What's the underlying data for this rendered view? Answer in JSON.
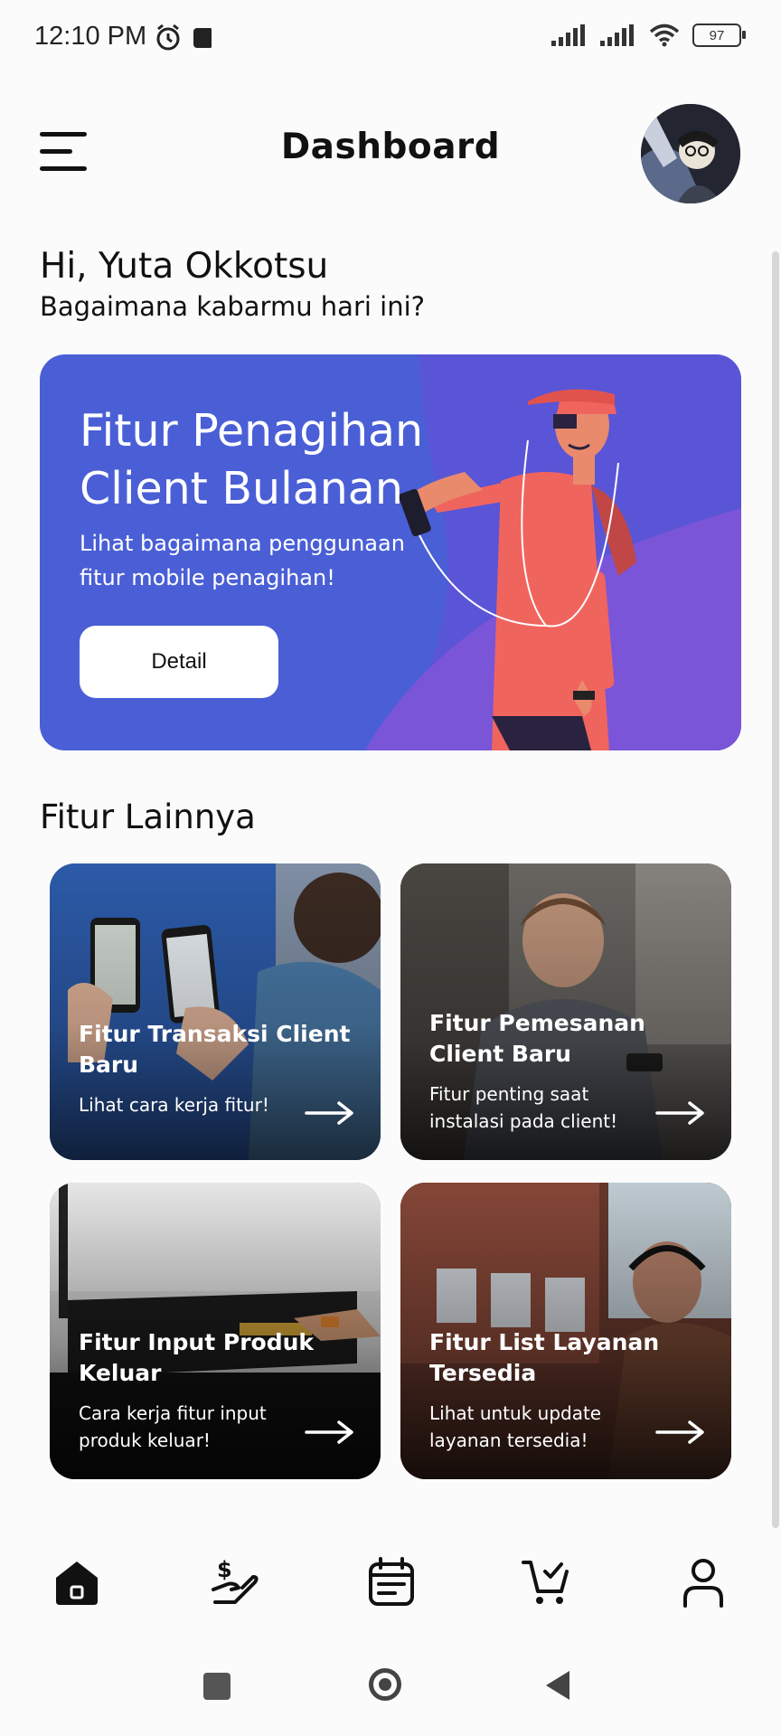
{
  "status_bar": {
    "time": "12:10 PM",
    "battery": "97",
    "icons": [
      "alarm-icon",
      "notification-square-icon",
      "signal-icon",
      "signal-icon",
      "wifi-icon",
      "battery-icon"
    ]
  },
  "header": {
    "title": "Dashboard",
    "menu_icon": "hamburger-menu-icon",
    "avatar_icon": "profile-avatar"
  },
  "greeting": {
    "line1": "Hi, Yuta Okkotsu",
    "line2": "Bagaimana kabarmu hari ini?"
  },
  "banner": {
    "title": "Fitur Penagihan Client Bulanan",
    "subtitle": "Lihat bagaimana penggunaan fitur mobile penagihan!",
    "button_label": "Detail",
    "colors": {
      "bg": "#4a5fd6",
      "accent": "#6b52d8",
      "figure_shirt": "#f0645e"
    }
  },
  "section": {
    "title": "Fitur Lainnya"
  },
  "cards": [
    {
      "title": "Fitur Transaksi Client Baru",
      "subtitle": "Lihat cara kerja fitur!",
      "arrow_icon": "arrow-right-icon"
    },
    {
      "title": "Fitur Pemesanan Client Baru",
      "subtitle": "Fitur penting saat instalasi pada client!",
      "arrow_icon": "arrow-right-icon"
    },
    {
      "title": "Fitur Input Produk Keluar",
      "subtitle": "Cara kerja fitur input produk keluar!",
      "arrow_icon": "arrow-right-icon"
    },
    {
      "title": "Fitur List Layanan Tersedia",
      "subtitle": "Lihat untuk update layanan tersedia!",
      "arrow_icon": "arrow-right-icon"
    }
  ],
  "bottom_nav": {
    "items": [
      "home-icon",
      "payment-hand-icon",
      "calendar-list-icon",
      "cart-check-icon",
      "user-icon"
    ],
    "active": "home-icon"
  },
  "system_nav": [
    "recents-icon",
    "home-circle-icon",
    "back-icon"
  ]
}
